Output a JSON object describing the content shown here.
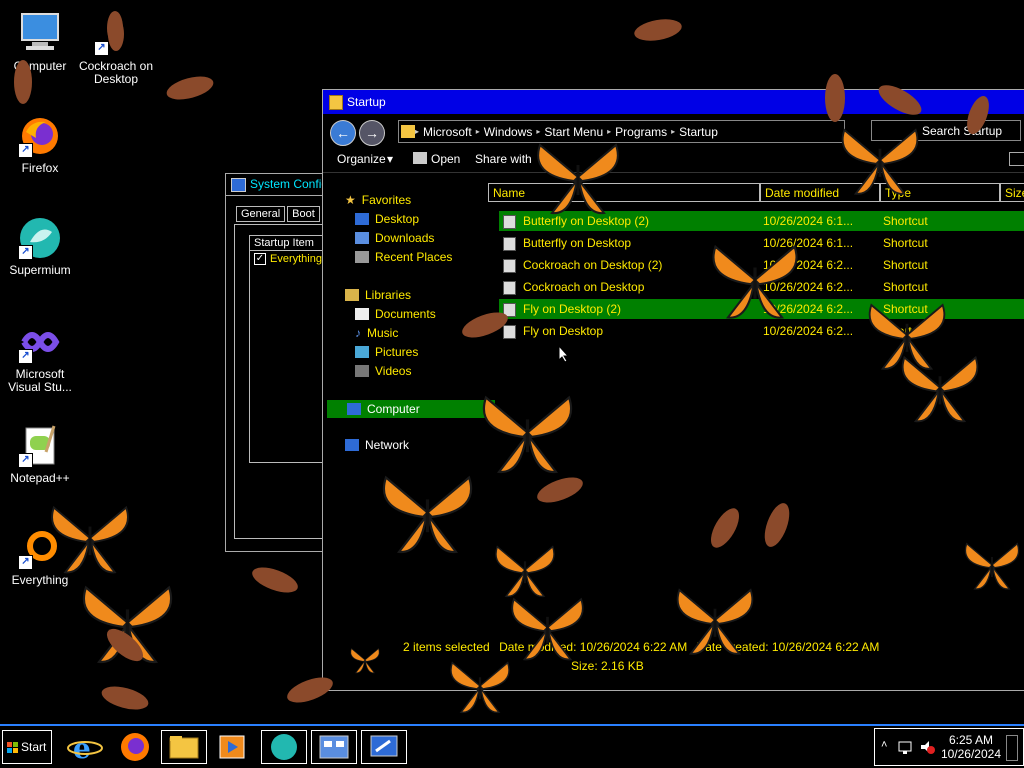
{
  "desktop": {
    "icons": [
      {
        "label": "Computer"
      },
      {
        "label": "Cockroach on Desktop"
      },
      {
        "label": "Firefox"
      },
      {
        "label": "Supermium"
      },
      {
        "label": "Microsoft Visual Stu..."
      },
      {
        "label": "Notepad++"
      },
      {
        "label": "Everything"
      }
    ]
  },
  "sysconfig": {
    "title": "System Configuration",
    "tabs": [
      "General",
      "Boot"
    ],
    "column_header": "Startup Item",
    "items": [
      {
        "label": "Everything",
        "checked": true
      }
    ]
  },
  "explorer": {
    "title": "Startup",
    "breadcrumb": [
      "Microsoft",
      "Windows",
      "Start Menu",
      "Programs",
      "Startup"
    ],
    "search_placeholder": "Search Startup",
    "commands": {
      "organize": "Organize",
      "open": "Open",
      "share": "Share with"
    },
    "nav": {
      "favorites": "Favorites",
      "desktop": "Desktop",
      "downloads": "Downloads",
      "recent": "Recent Places",
      "libraries": "Libraries",
      "documents": "Documents",
      "music": "Music",
      "pictures": "Pictures",
      "videos": "Videos",
      "computer": "Computer",
      "network": "Network"
    },
    "columns": {
      "name": "Name",
      "date": "Date modified",
      "type": "Type",
      "size": "Size"
    },
    "files": [
      {
        "name": "Butterfly on Desktop (2)",
        "date": "10/26/2024 6:1...",
        "type": "Shortcut",
        "selected": true
      },
      {
        "name": "Butterfly on Desktop",
        "date": "10/26/2024 6:1...",
        "type": "Shortcut",
        "selected": false
      },
      {
        "name": "Cockroach on Desktop (2)",
        "date": "10/26/2024 6:2...",
        "type": "Shortcut",
        "selected": false
      },
      {
        "name": "Cockroach on Desktop",
        "date": "10/26/2024 6:2...",
        "type": "Shortcut",
        "selected": false
      },
      {
        "name": "Fly on Desktop (2)",
        "date": "10/26/2024 6:2...",
        "type": "Shortcut",
        "selected": true
      },
      {
        "name": "Fly on Desktop",
        "date": "10/26/2024 6:2...",
        "type": "Shortcut",
        "selected": false
      }
    ],
    "status": {
      "selected": "2 items selected",
      "date_modified": "Date modified: 10/26/2024 6:22 AM",
      "date_created": "Date created: 10/26/2024 6:22 AM",
      "size": "Size: 2.16 KB"
    }
  },
  "taskbar": {
    "start_label": "Start",
    "time": "6:25 AM",
    "date": "10/26/2024",
    "accent": "#2a80ff"
  },
  "colors": {
    "selection": "#008000",
    "file_text": "#ffea00",
    "titlebar": "#0000e6"
  }
}
